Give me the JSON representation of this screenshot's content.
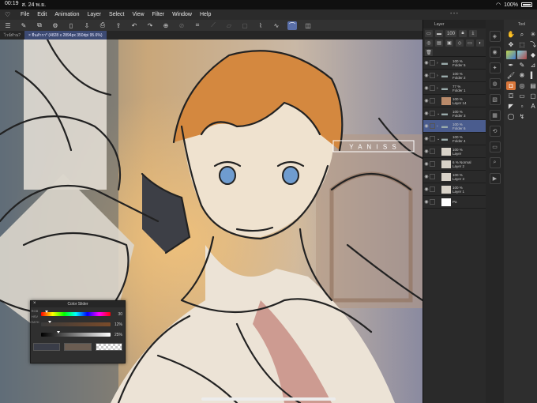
{
  "status": {
    "time": "00:19",
    "date": "ส. 24 พ.ย.",
    "battery": "100%"
  },
  "menu": [
    "File",
    "Edit",
    "Animation",
    "Layer",
    "Select",
    "View",
    "Filter",
    "Window",
    "Help"
  ],
  "toolbar": {
    "buttons": [
      "menu-icon",
      "pen-tool-icon",
      "stack-icon",
      "settings-icon",
      "new-doc-icon",
      "save-icon",
      "print-icon",
      "export-icon",
      "undo-icon",
      "redo-icon",
      "transform-icon",
      "snap-icon",
      "grid-icon",
      "ruler-icon",
      "perspective-icon",
      "select-icon",
      "brush-icon",
      "blend-icon",
      "curve-icon",
      "layer-icon"
    ]
  },
  "tabs": [
    {
      "label": "ไวน์ทำน?"
    },
    {
      "label": "× ยืนสำรา* (4828 x 2894px 350dpi 95.6%)"
    }
  ],
  "layer_panel": {
    "title": "Layer",
    "opacity": "100",
    "layers": [
      {
        "opacity": "100 %",
        "name": "Folder 5",
        "type": "folder",
        "chevron": "›",
        "selected": false
      },
      {
        "opacity": "100 %",
        "name": "Folder 2",
        "type": "folder",
        "chevron": "›",
        "selected": false
      },
      {
        "opacity": "77 %",
        "name": "Folder 1",
        "type": "folder",
        "chevron": "›",
        "selected": false
      },
      {
        "opacity": "100 %",
        "name": "Layer 14",
        "type": "image",
        "chevron": "",
        "selected": false
      },
      {
        "opacity": "100 %",
        "name": "Folder 3",
        "type": "folder",
        "chevron": "⌄",
        "selected": false
      },
      {
        "opacity": "100 %",
        "name": "Folder 6",
        "type": "folder",
        "chevron": "›",
        "selected": true
      },
      {
        "opacity": "100 %",
        "name": "Folder 4",
        "type": "folder",
        "chevron": "⌄",
        "selected": false
      },
      {
        "opacity": "100 %",
        "name": "Layer",
        "type": "image",
        "chevron": "",
        "selected": false
      },
      {
        "opacity": "6 % Normal",
        "name": "Layer 2",
        "type": "image",
        "chevron": "",
        "selected": false
      },
      {
        "opacity": "100 %",
        "name": "Layer 3",
        "type": "image",
        "chevron": "",
        "selected": false
      },
      {
        "opacity": "100 %",
        "name": "Layer 1",
        "type": "image",
        "chevron": "",
        "selected": false
      },
      {
        "opacity": "",
        "name": "Pa",
        "type": "paper",
        "chevron": "",
        "selected": false
      }
    ]
  },
  "tool_panel": {
    "title": "Tool"
  },
  "canvas": {
    "watermark": "Y A N I S S"
  },
  "color_slider": {
    "title": "Color Slider",
    "tabs": [
      "RGB",
      "HSV",
      "CMYK"
    ],
    "rows": [
      {
        "label": "H",
        "value": "30",
        "level": 0.083
      },
      {
        "label": "S",
        "value": "12%",
        "level": 0.12
      },
      {
        "label": "V",
        "value": "25%",
        "level": 0.25
      }
    ],
    "swatch_main": "#3a3d48",
    "swatch_sub": "#6b5d52",
    "swatch_transparent": "transparent"
  },
  "colors": {
    "accent": "#4a5c8e",
    "tool_selected": "#d9763a",
    "sketch_line": "#222222",
    "hair": "#d4883f",
    "eyes": "#6f9ccf"
  }
}
